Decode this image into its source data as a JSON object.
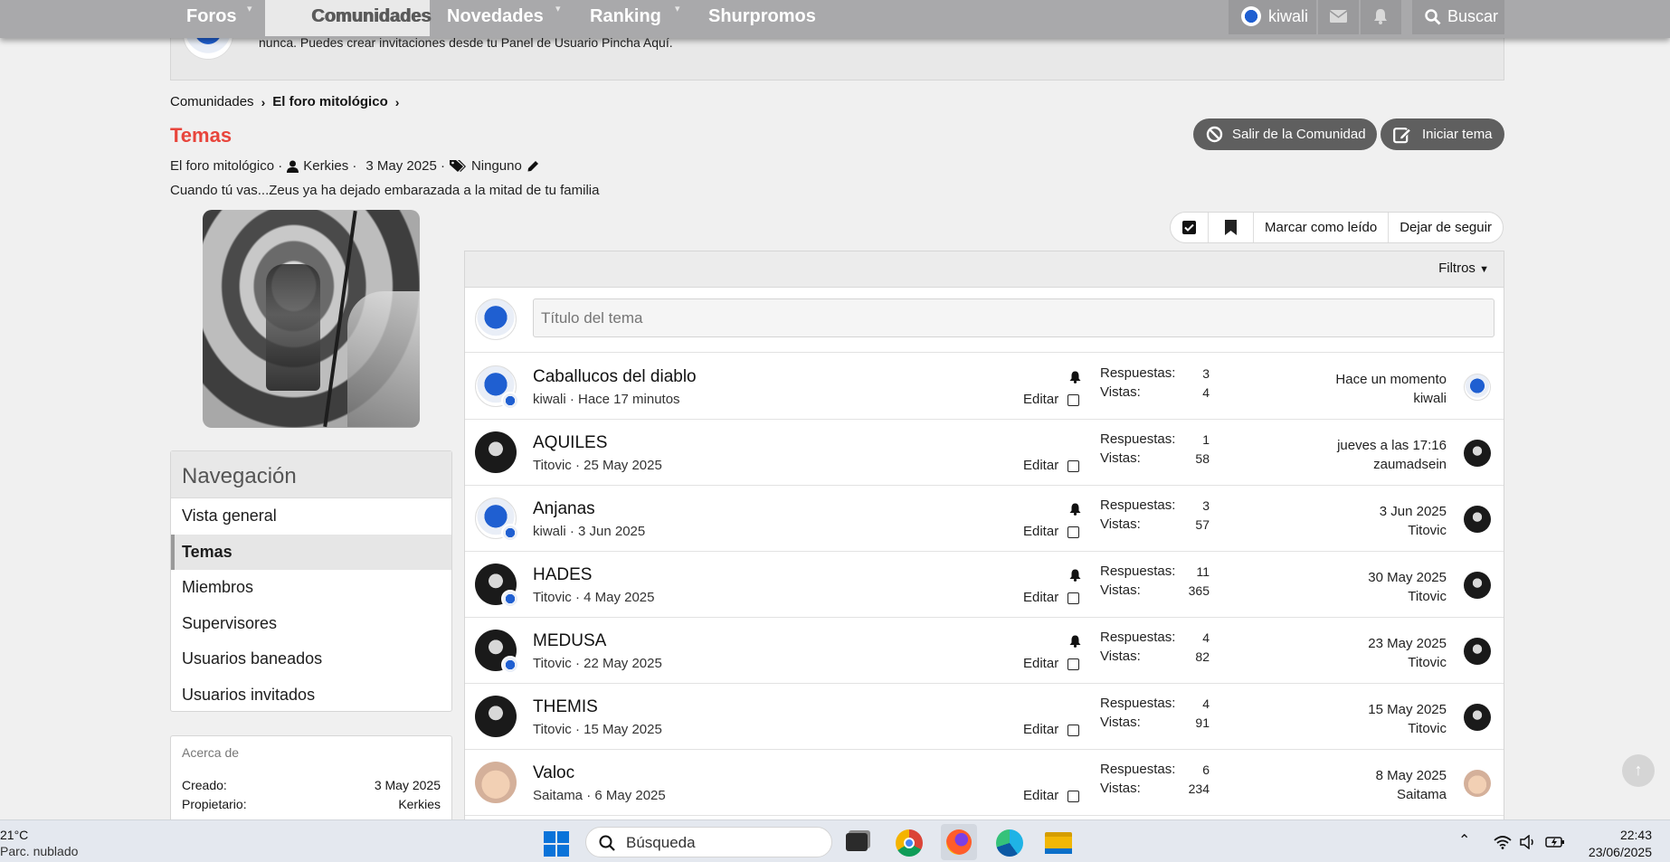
{
  "topnav": {
    "tabs": [
      {
        "label": "Foros"
      },
      {
        "label": "Comunidades"
      },
      {
        "label": "Novedades"
      },
      {
        "label": "Ranking"
      },
      {
        "label": "Shurpromos"
      }
    ],
    "user": "kiwali",
    "search": "Buscar"
  },
  "notice": {
    "text": "nunca. Puedes crear invitaciones desde tu Panel de Usuario Pincha Aquí."
  },
  "breadcrumb": {
    "items": [
      "Comunidades",
      "El foro mitológico"
    ]
  },
  "page": {
    "title": "Temas",
    "meta_forum": "El foro mitológico ·",
    "meta_owner": "Kerkies ·",
    "meta_date": "3 May 2025 ·",
    "meta_tags": "Ninguno",
    "description": "Cuando tú vas...Zeus ya ha dejado embarazada a la mitad de tu familia"
  },
  "actions": {
    "leave": "Salir de la Comunidad",
    "new_thread": "Iniciar tema"
  },
  "toolbar": {
    "mark_read": "Marcar como leído",
    "unfollow": "Dejar de seguir"
  },
  "sidebar": {
    "nav_title": "Navegación",
    "items": [
      {
        "label": "Vista general"
      },
      {
        "label": "Temas"
      },
      {
        "label": "Miembros"
      },
      {
        "label": "Supervisores"
      },
      {
        "label": "Usuarios baneados"
      },
      {
        "label": "Usuarios invitados"
      }
    ],
    "about": {
      "title": "Acerca de",
      "created_label": "Creado:",
      "created_value": "3 May 2025",
      "owner_label": "Propietario:",
      "owner_value": "Kerkies"
    }
  },
  "threads": {
    "filters": "Filtros",
    "new_title_placeholder": "Título del tema",
    "replies_label": "Respuestas:",
    "views_label": "Vistas:",
    "edit_label": "Editar",
    "rows": [
      {
        "title": "Caballucos del diablo",
        "meta": "kiwali · Hace 17 minutos",
        "replies": "3",
        "views": "4",
        "last_date": "Hace un momento",
        "last_user": "kiwali"
      },
      {
        "title": "AQUILES",
        "meta": "Titovic · 25 May 2025",
        "replies": "1",
        "views": "58",
        "last_date": "jueves a las 17:16",
        "last_user": "zaumadsein"
      },
      {
        "title": "Anjanas",
        "meta": "kiwali · 3 Jun 2025",
        "replies": "3",
        "views": "57",
        "last_date": "3 Jun 2025",
        "last_user": "Titovic"
      },
      {
        "title": "HADES",
        "meta": "Titovic · 4 May 2025",
        "replies": "11",
        "views": "365",
        "last_date": "30 May 2025",
        "last_user": "Titovic"
      },
      {
        "title": "MEDUSA",
        "meta": "Titovic · 22 May 2025",
        "replies": "4",
        "views": "82",
        "last_date": "23 May 2025",
        "last_user": "Titovic"
      },
      {
        "title": "THEMIS",
        "meta": "Titovic · 15 May 2025",
        "replies": "4",
        "views": "91",
        "last_date": "15 May 2025",
        "last_user": "Titovic"
      },
      {
        "title": "Valoc",
        "meta": "Saitama · 6 May 2025",
        "replies": "6",
        "views": "234",
        "last_date": "8 May 2025",
        "last_user": "Saitama"
      }
    ]
  },
  "taskbar": {
    "weather_temp": "21°C",
    "weather_desc": "Parc. nublado",
    "search": "Búsqueda",
    "time": "22:43",
    "date": "23/06/2025"
  },
  "colors": {
    "accent_title": "#e8453c",
    "nav_bg": "#a9a9ab",
    "pill_bg": "#5f5f5f"
  }
}
